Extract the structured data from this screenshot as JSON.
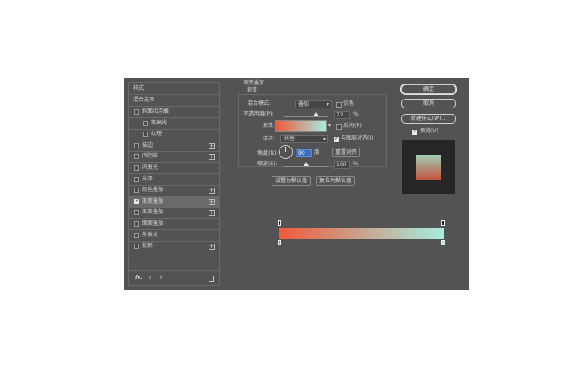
{
  "styles_panel": {
    "header": "样式",
    "blend_options": "混合选项",
    "items": [
      {
        "label": "斜面和浮雕",
        "checked": false,
        "plus": false
      },
      {
        "label": "等高线",
        "checked": false,
        "plus": false
      },
      {
        "label": "纹理",
        "checked": false,
        "plus": false
      },
      {
        "label": "描边",
        "checked": false,
        "plus": true
      },
      {
        "label": "内阴影",
        "checked": false,
        "plus": true
      },
      {
        "label": "内发光",
        "checked": false,
        "plus": false
      },
      {
        "label": "光泽",
        "checked": false,
        "plus": false
      },
      {
        "label": "颜色叠加",
        "checked": false,
        "plus": true
      },
      {
        "label": "渐变叠加",
        "checked": true,
        "plus": true
      },
      {
        "label": "渐变叠加",
        "checked": false,
        "plus": true
      },
      {
        "label": "图案叠加",
        "checked": false,
        "plus": false
      },
      {
        "label": "外发光",
        "checked": false,
        "plus": false
      },
      {
        "label": "投影",
        "checked": false,
        "plus": true
      }
    ],
    "footer_fx": "fx.",
    "footer_up": "⇧",
    "footer_down": "⇩",
    "footer_trash": "🗑"
  },
  "gradient_overlay": {
    "section_title": "渐变叠加",
    "subtitle": "渐变",
    "blend_mode_label": "混合模式:",
    "blend_mode_value": "叠加",
    "dither_label": "仿色",
    "opacity_label": "不透明度(P):",
    "opacity_value": "72",
    "opacity_unit": "%",
    "opacity_fraction": 0.72,
    "gradient_label": "渐变:",
    "reverse_label": "反向(R)",
    "style_label": "样式:",
    "style_value": "线性",
    "align_label": "与图层对齐(I)",
    "angle_label": "角度(N):",
    "angle_value": "90",
    "angle_unit": "度",
    "reset_align_button": "重置对齐",
    "scale_label": "缩放(S):",
    "scale_value": "100",
    "scale_unit": "%",
    "scale_fraction": 0.5,
    "set_default_button": "设置为默认值",
    "reset_default_button": "复位为默认值"
  },
  "buttons": {
    "ok": "确定",
    "cancel": "取消",
    "new_style": "新建样式(W)...",
    "preview_label": "预览(V)"
  },
  "colors": {
    "gradient_start": "#ee5a3a",
    "gradient_end": "#a6ece0",
    "preview_top": "#9fcfb8",
    "preview_bottom": "#c5553f",
    "selection": "#6a6a6a",
    "dialog_bg": "#535353"
  }
}
